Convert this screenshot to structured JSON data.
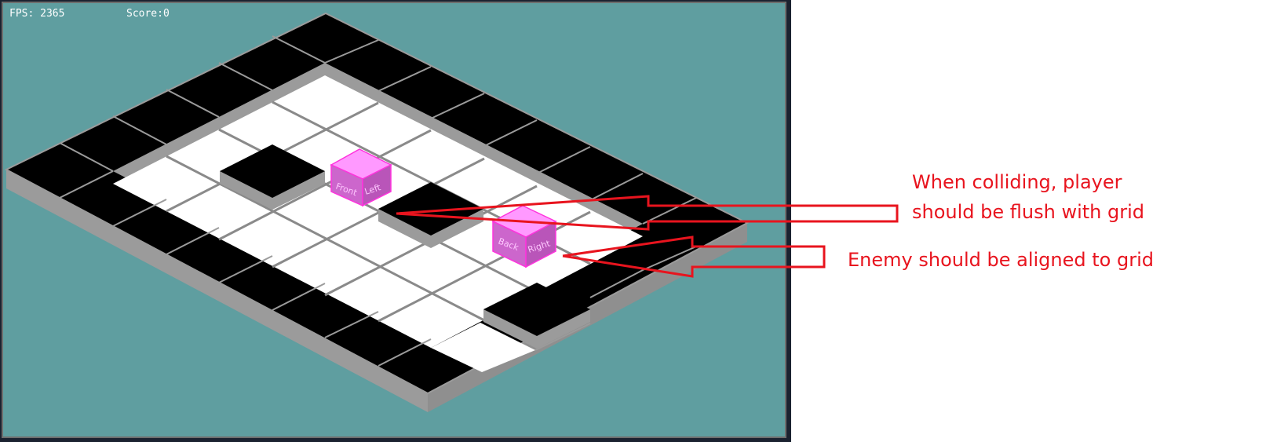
{
  "hud": {
    "fps": "FPS: 2365",
    "score": "Score:0"
  },
  "faces": {
    "player_front": "Front",
    "player_left": "Left",
    "enemy_back": "Back",
    "enemy_right": "Right"
  },
  "annotations": {
    "collision_line1": "When colliding, player",
    "collision_line2": "should be flush with grid",
    "enemy_line": "Enemy should be aligned to grid"
  },
  "colors": {
    "background": "#5f9ea0",
    "wall": "#000000",
    "wall_side": "#9b9b9b",
    "floor": "#ffffff",
    "grid_line": "#8a8a8a",
    "cube_top": "#ff99ff",
    "cube_side": "#cc66cc",
    "cube_outline": "#ff33dd",
    "annotation": "#e8141e"
  }
}
